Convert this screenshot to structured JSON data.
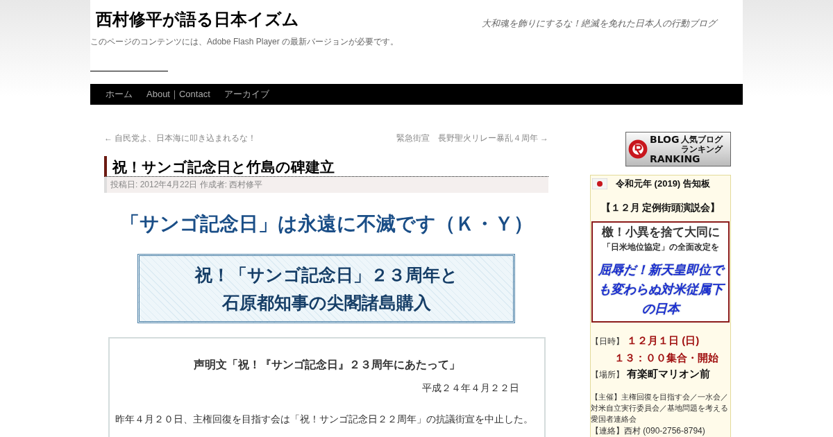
{
  "site": {
    "title": "西村修平が語る日本イズム",
    "tagline": "大和魂を飾りにするな！絶滅を免れた日本人の行動ブログ",
    "flash_notice": "このページのコンテンツには、Adobe Flash Player の最新バージョンが必要です。"
  },
  "nav": [
    {
      "label": "ホーム"
    },
    {
      "label": "About｜Contact"
    },
    {
      "label": "アーカイブ"
    }
  ],
  "post_nav": {
    "previous": "← 自民党よ、日本海に叩き込まれるな！",
    "next": "緊急街宣　長野聖火リレー暴乱４周年 →"
  },
  "post": {
    "title": "祝！サンゴ記念日と竹島の碑建立",
    "meta_label": "投稿日:",
    "date": "2012年4月22日",
    "author_label": "作成者:",
    "author": "西村修平",
    "headline": "「サンゴ記念日」は永遠に不滅です（Ｋ・Ｙ）",
    "banner_lines": [
      "祝！「サンゴ記念日」２３周年と",
      "石原都知事の尖閣諸島購入"
    ],
    "statement": {
      "title": "声明文「祝！『サンゴ記念日』２３周年にあたって」",
      "date": "平成２４年４月２２日",
      "paragraph": "昨年４月２０日、主権回復を目指す会は「祝！サンゴ記念日２２周年」の抗議街宣を中止した。"
    }
  },
  "sidebar": {
    "ranking_banner": {
      "line_1": "BLOG",
      "line_2": "RANKING",
      "small_lines": [
        "人気ブログ",
        "ランキング"
      ]
    },
    "notice": {
      "title": "令和元年 (2019) 告知板",
      "event": "【１２月 定例街頭演説会】",
      "slogan": "檄！小異を捨て大同に",
      "subtitle": "「日米地位協定」の全面改定を",
      "highlight": "屈辱だ！新天皇即位でも変わらぬ対米従属下の日本",
      "details": [
        {
          "label": "【日時】",
          "value": "１２月１日 (日)",
          "kind": "red"
        },
        {
          "value": "１３：００集合・開始",
          "kind": "red"
        },
        {
          "label": "【場所】",
          "value": "有楽町マリオン前",
          "kind": "black"
        }
      ],
      "organizers": "【主催】主権回復を目指す会／一水会／対米自立実行委員会／基地問題を考える愛国者連絡会",
      "contact": "【連絡】西村 (090-2756-8794)"
    }
  }
}
